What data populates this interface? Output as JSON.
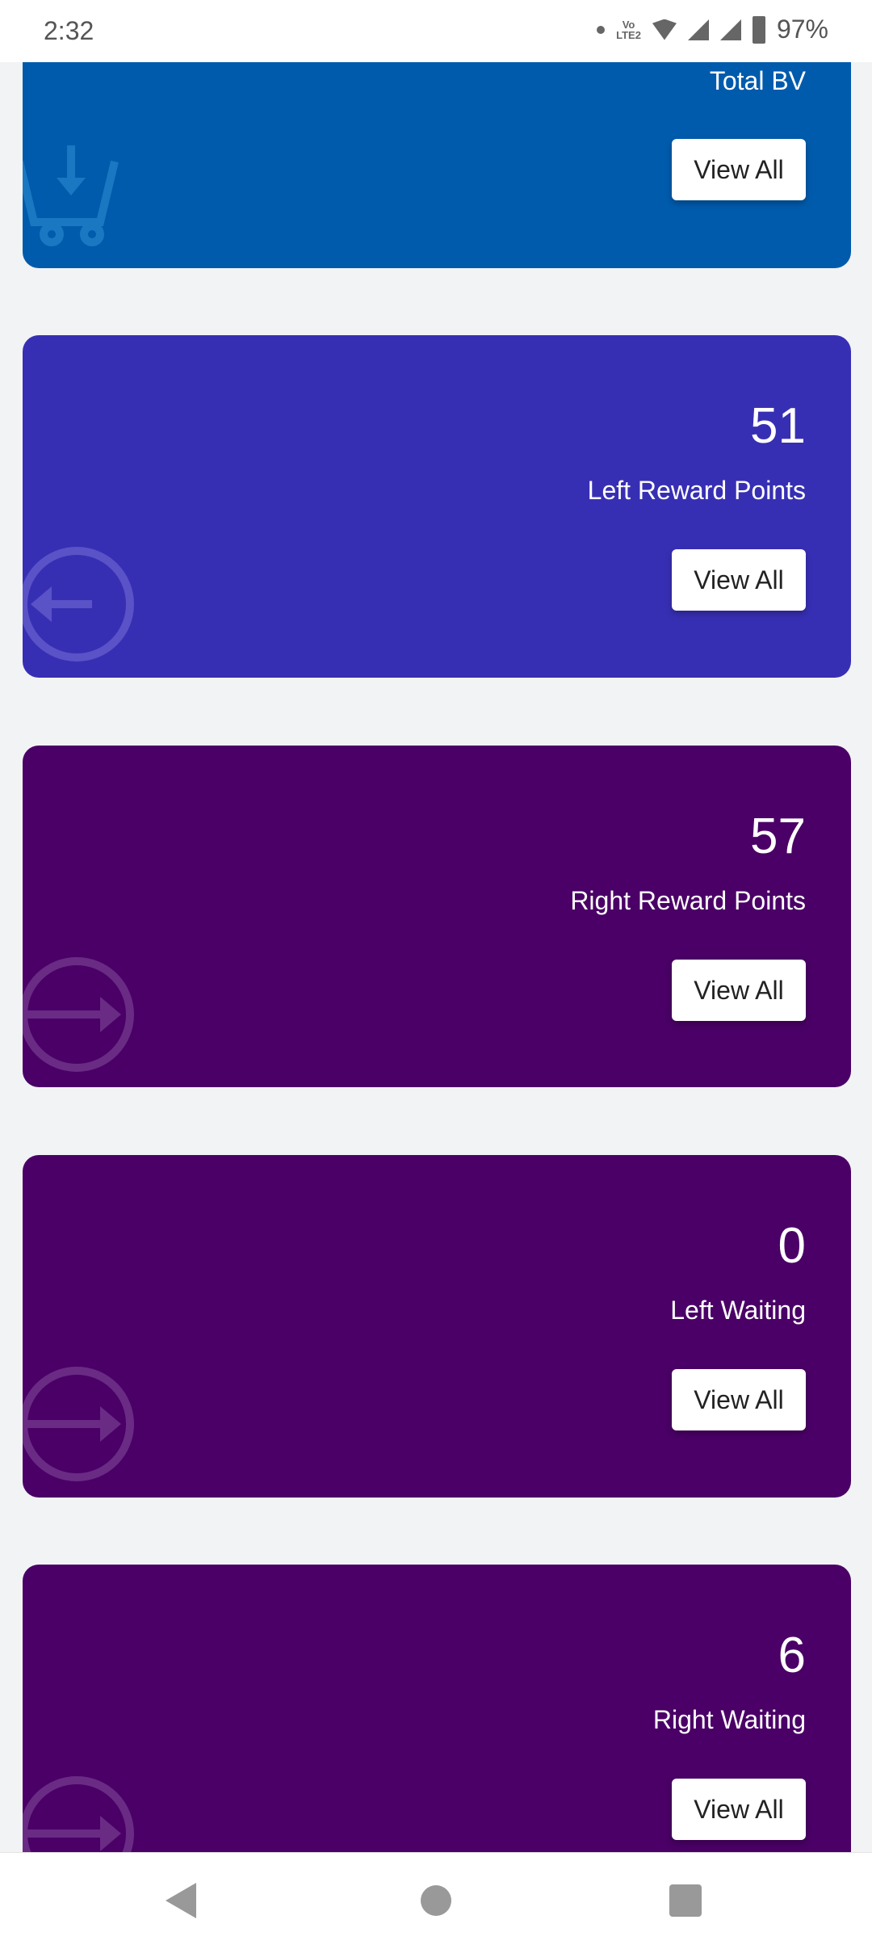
{
  "status_bar": {
    "time": "2:32",
    "network": "Vo LTE2",
    "battery": "97%"
  },
  "cards": [
    {
      "label": "Total BV",
      "button": "View All",
      "color": "#005bac",
      "icon": "cart-download-icon"
    },
    {
      "value": "51",
      "label": "Left Reward Points",
      "button": "View All",
      "color": "#372fb3",
      "icon": "arrow-left-circle-icon"
    },
    {
      "value": "57",
      "label": "Right Reward Points",
      "button": "View All",
      "color": "#4a0066",
      "icon": "arrow-right-circle-icon"
    },
    {
      "value": "0",
      "label": "Left Waiting",
      "button": "View All",
      "color": "#4a0066",
      "icon": "arrow-right-circle-icon"
    },
    {
      "value": "6",
      "label": "Right Waiting",
      "button": "View All",
      "color": "#4a0066",
      "icon": "arrow-right-circle-icon"
    }
  ],
  "nav_bar": {
    "back": "back-icon",
    "home": "home-icon",
    "recents": "recents-icon"
  }
}
